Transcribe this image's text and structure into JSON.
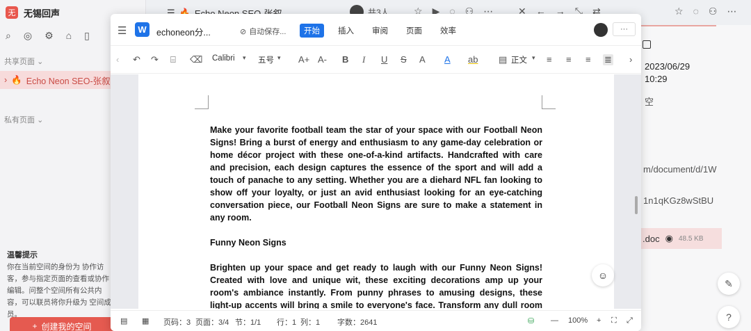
{
  "sidebar": {
    "logo_char": "无",
    "title": "无锡回声",
    "shared_section": "共享页面",
    "active_item": "Echo Neon SEO-张叙",
    "private_section": "私有页面",
    "tip_title": "温馨提示",
    "tip_body": "你在当前空间的身份为 协作访客，参与指定页面的查看或协作编辑。问整个空间所有公共内容，可以联员将你升级为 空间成员。",
    "create_button": "创建我的空间"
  },
  "browser": {
    "tab_title": "Echo Neon SEO-张叙",
    "members_count": "共3人"
  },
  "right_panel": {
    "date": "2023/06/29",
    "time": "10:29",
    "empty_label": "空",
    "url_line1": "m/document/d/1W",
    "url_line2": "1n1qKGz8wStBU",
    "file_ext": ".doc",
    "file_size": "48.5 KB"
  },
  "editor": {
    "logo_char": "W",
    "doc_name": "echoneon分...",
    "autosave": "自动保存...",
    "tabs": [
      "开始",
      "插入",
      "审阅",
      "页面",
      "效率"
    ],
    "more": "···",
    "toolbar": {
      "font": "Calibri",
      "size": "五号",
      "grow": "A+",
      "shrink": "A-",
      "bold": "B",
      "italic": "I",
      "underline": "U",
      "strike": "S",
      "text_effect": "A",
      "font_color": "A",
      "highlight": "ab",
      "paragraph": "正文"
    },
    "paragraphs": [
      "Make your favorite football team the star of your space with our Football Neon Signs! Bring a burst of energy and enthusiasm to any game-day celebration or home décor project with these one-of-a-kind artifacts. Handcrafted with care and precision, each design captures the essence of the sport and will add a touch of panache to any setting. Whether you are a diehard NFL fan looking to show off your loyalty, or just an avid enthusiast looking for an eye-catching conversation piece, our Football Neon Signs are sure to make a statement in any room.",
      "Funny Neon Signs",
      "Brighten up your space and get ready to laugh with our Funny Neon Signs! Created with love and unique wit, these exciting decorations amp up your room's ambiance instantly. From punny phrases to amusing designs, these light-up accents will bring a smile to everyone's face. Transform any dull room into a bright, inviting hangout space with this delightful lighting feature. Get the"
    ],
    "status": {
      "page_no": "页码：3",
      "page_total": "页面：3/4",
      "section": "节：1/1",
      "row": "行：1",
      "col": "列：1",
      "words": "字数：2641",
      "zoom": "100%"
    }
  },
  "colors": {
    "accent_blue": "#1e73e8",
    "brand_red": "#e55a50"
  }
}
